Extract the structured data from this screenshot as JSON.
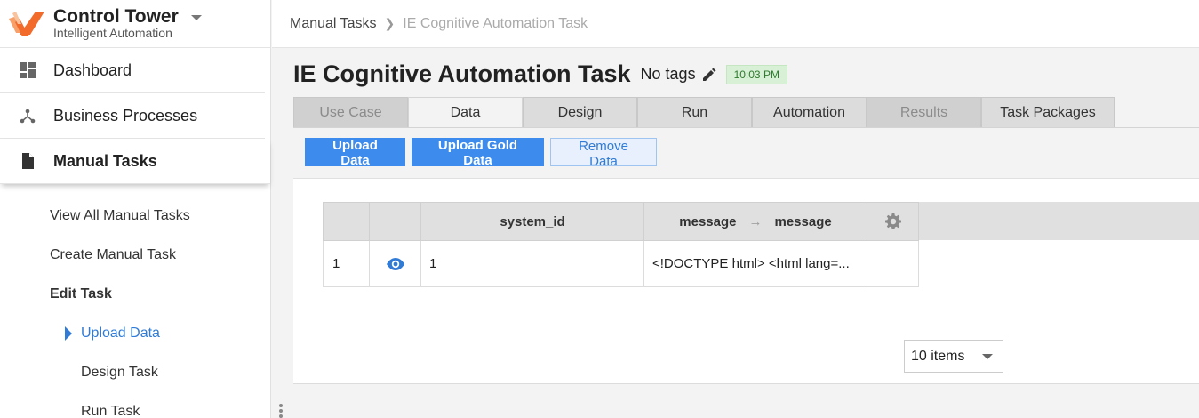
{
  "brand": {
    "title": "Control Tower",
    "subtitle": "Intelligent Automation",
    "accent": "#f26b2b"
  },
  "nav": {
    "items": [
      {
        "label": "Dashboard",
        "icon": "dashboard-icon"
      },
      {
        "label": "Business Processes",
        "icon": "process-icon"
      },
      {
        "label": "Manual Tasks",
        "icon": "document-icon",
        "active": true
      }
    ],
    "sub_items": [
      {
        "label": "View All Manual Tasks"
      },
      {
        "label": "Create Manual Task"
      },
      {
        "label": "Edit Task"
      },
      {
        "label": "Upload Data",
        "current": true
      },
      {
        "label": "Design Task"
      },
      {
        "label": "Run Task"
      }
    ]
  },
  "breadcrumb": {
    "parent": "Manual Tasks",
    "current": "IE Cognitive Automation Task"
  },
  "page": {
    "title": "IE Cognitive Automation Task",
    "tags": "No tags",
    "time": "10:03 PM"
  },
  "tabs": [
    {
      "label": "Use Case",
      "state": "disabled"
    },
    {
      "label": "Data",
      "state": "active"
    },
    {
      "label": "Design",
      "state": "normal"
    },
    {
      "label": "Run",
      "state": "normal"
    },
    {
      "label": "Automation",
      "state": "normal"
    },
    {
      "label": "Results",
      "state": "disabled"
    },
    {
      "label": "Task Packages",
      "state": "normal"
    }
  ],
  "toolbar": {
    "upload": "Upload Data",
    "upload_gold": "Upload Gold Data",
    "remove": "Remove Data"
  },
  "grid": {
    "headers": {
      "system_id": "system_id",
      "message_from": "message",
      "message_to": "message"
    },
    "rows": [
      {
        "index": "1",
        "system_id": "1",
        "message": "<!DOCTYPE html> <html lang=..."
      }
    ]
  },
  "pager": {
    "page_size": "10 items"
  },
  "colors": {
    "primary": "#3d8ced",
    "link": "#2f7bd6",
    "badge_bg": "#d8f0d6"
  }
}
